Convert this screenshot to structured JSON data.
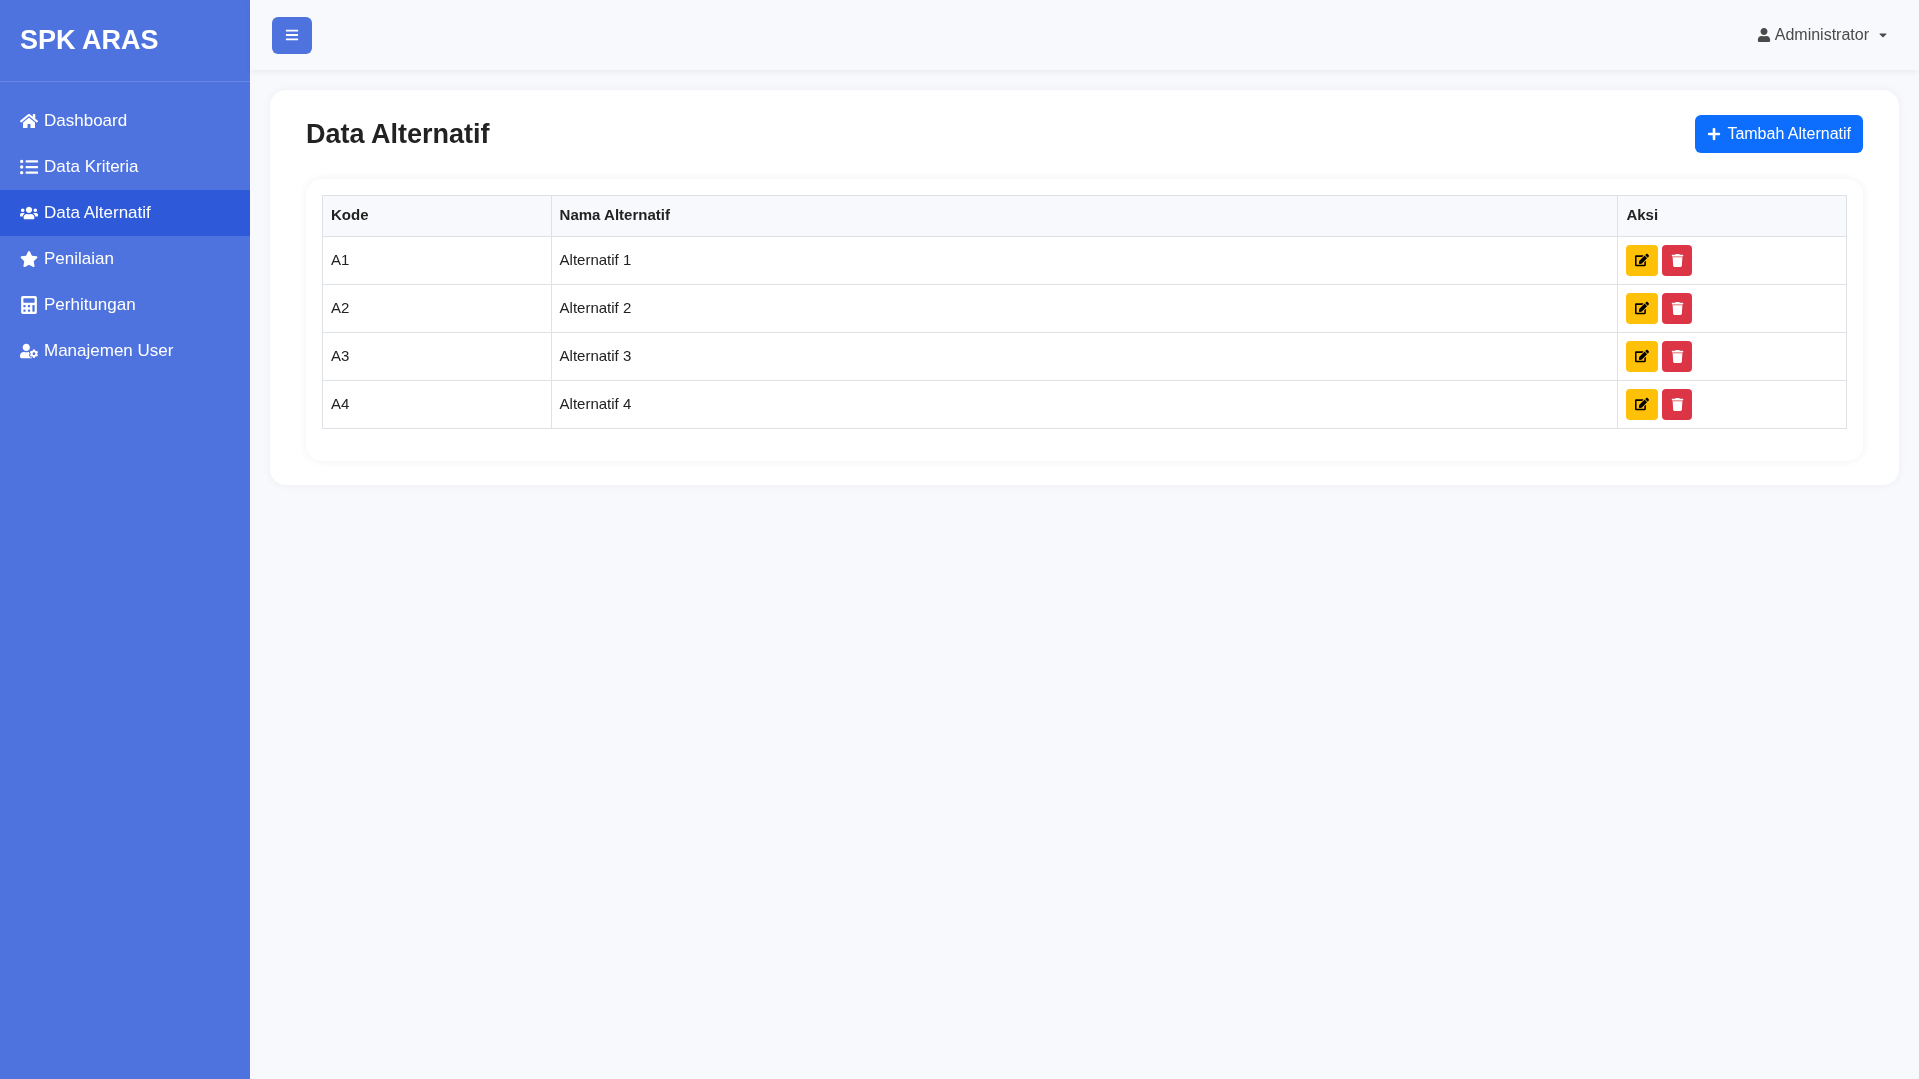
{
  "sidebar": {
    "brand": "SPK ARAS",
    "items": [
      {
        "kind": "home",
        "label": "Dashboard",
        "selected": false
      },
      {
        "kind": "list",
        "label": "Data Kriteria",
        "selected": false
      },
      {
        "kind": "users",
        "label": "Data Alternatif",
        "selected": true
      },
      {
        "kind": "star",
        "label": "Penilaian",
        "selected": false
      },
      {
        "kind": "calculator",
        "label": "Perhitungan",
        "selected": false
      },
      {
        "kind": "usercog",
        "label": "Manajemen User",
        "selected": false
      }
    ]
  },
  "topbar": {
    "user": "Administrator"
  },
  "page": {
    "title": "Data Alternatif",
    "add_button": "Tambah Alternatif"
  },
  "table": {
    "columns": [
      "Kode",
      "Nama Alternatif",
      "Aksi"
    ],
    "rows": [
      {
        "code": "A1",
        "name": "Alternatif 1"
      },
      {
        "code": "A2",
        "name": "Alternatif 2"
      },
      {
        "code": "A3",
        "name": "Alternatif 3"
      },
      {
        "code": "A4",
        "name": "Alternatif 4"
      }
    ]
  }
}
